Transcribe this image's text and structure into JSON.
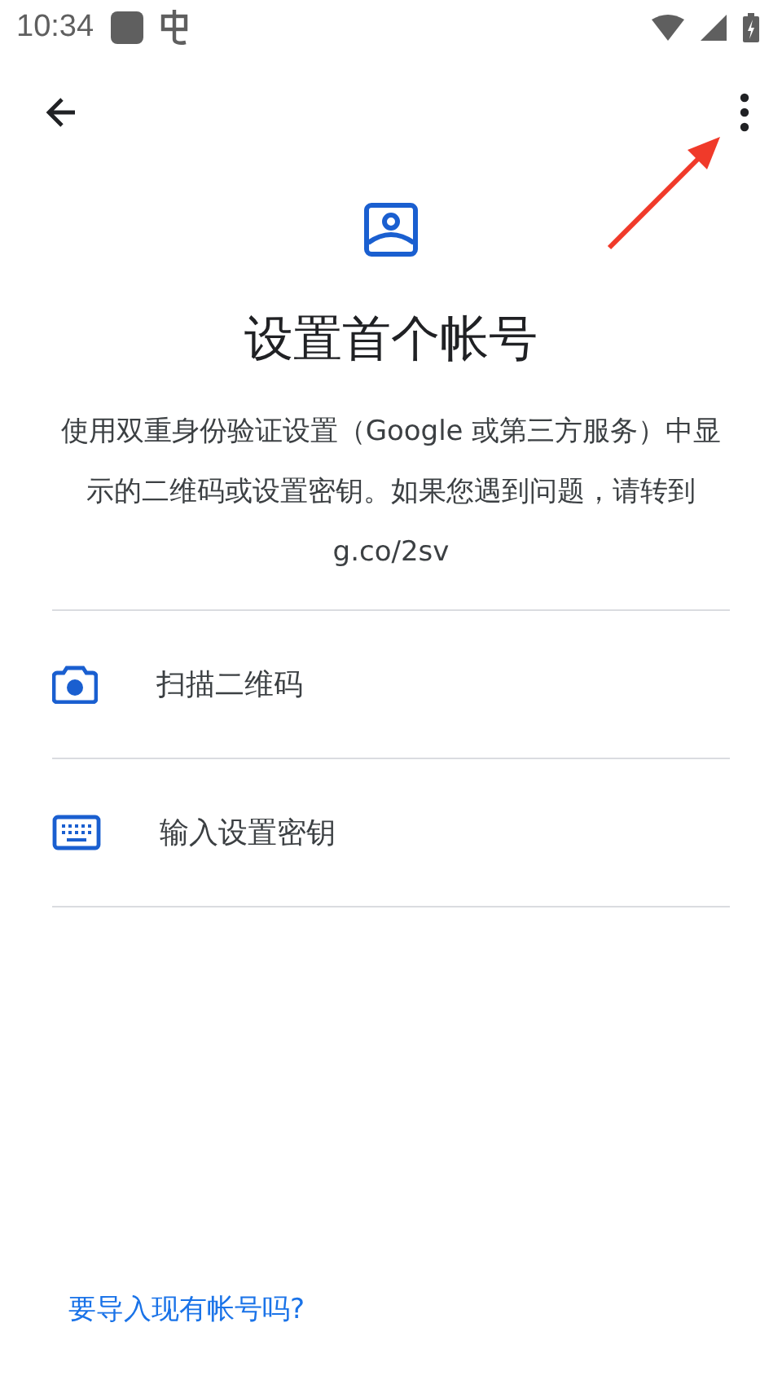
{
  "status_bar": {
    "time": "10:34"
  },
  "title": "设置首个帐号",
  "description": "使用双重身份验证设置（Google 或第三方服务）中显示的二维码或设置密钥。如果您遇到问题，请转到 g.co/2sv",
  "options": [
    {
      "kind": "camera",
      "label": "扫描二维码"
    },
    {
      "kind": "keyboard",
      "label": "输入设置密钥"
    }
  ],
  "import_link": "要导入现有帐号吗?"
}
